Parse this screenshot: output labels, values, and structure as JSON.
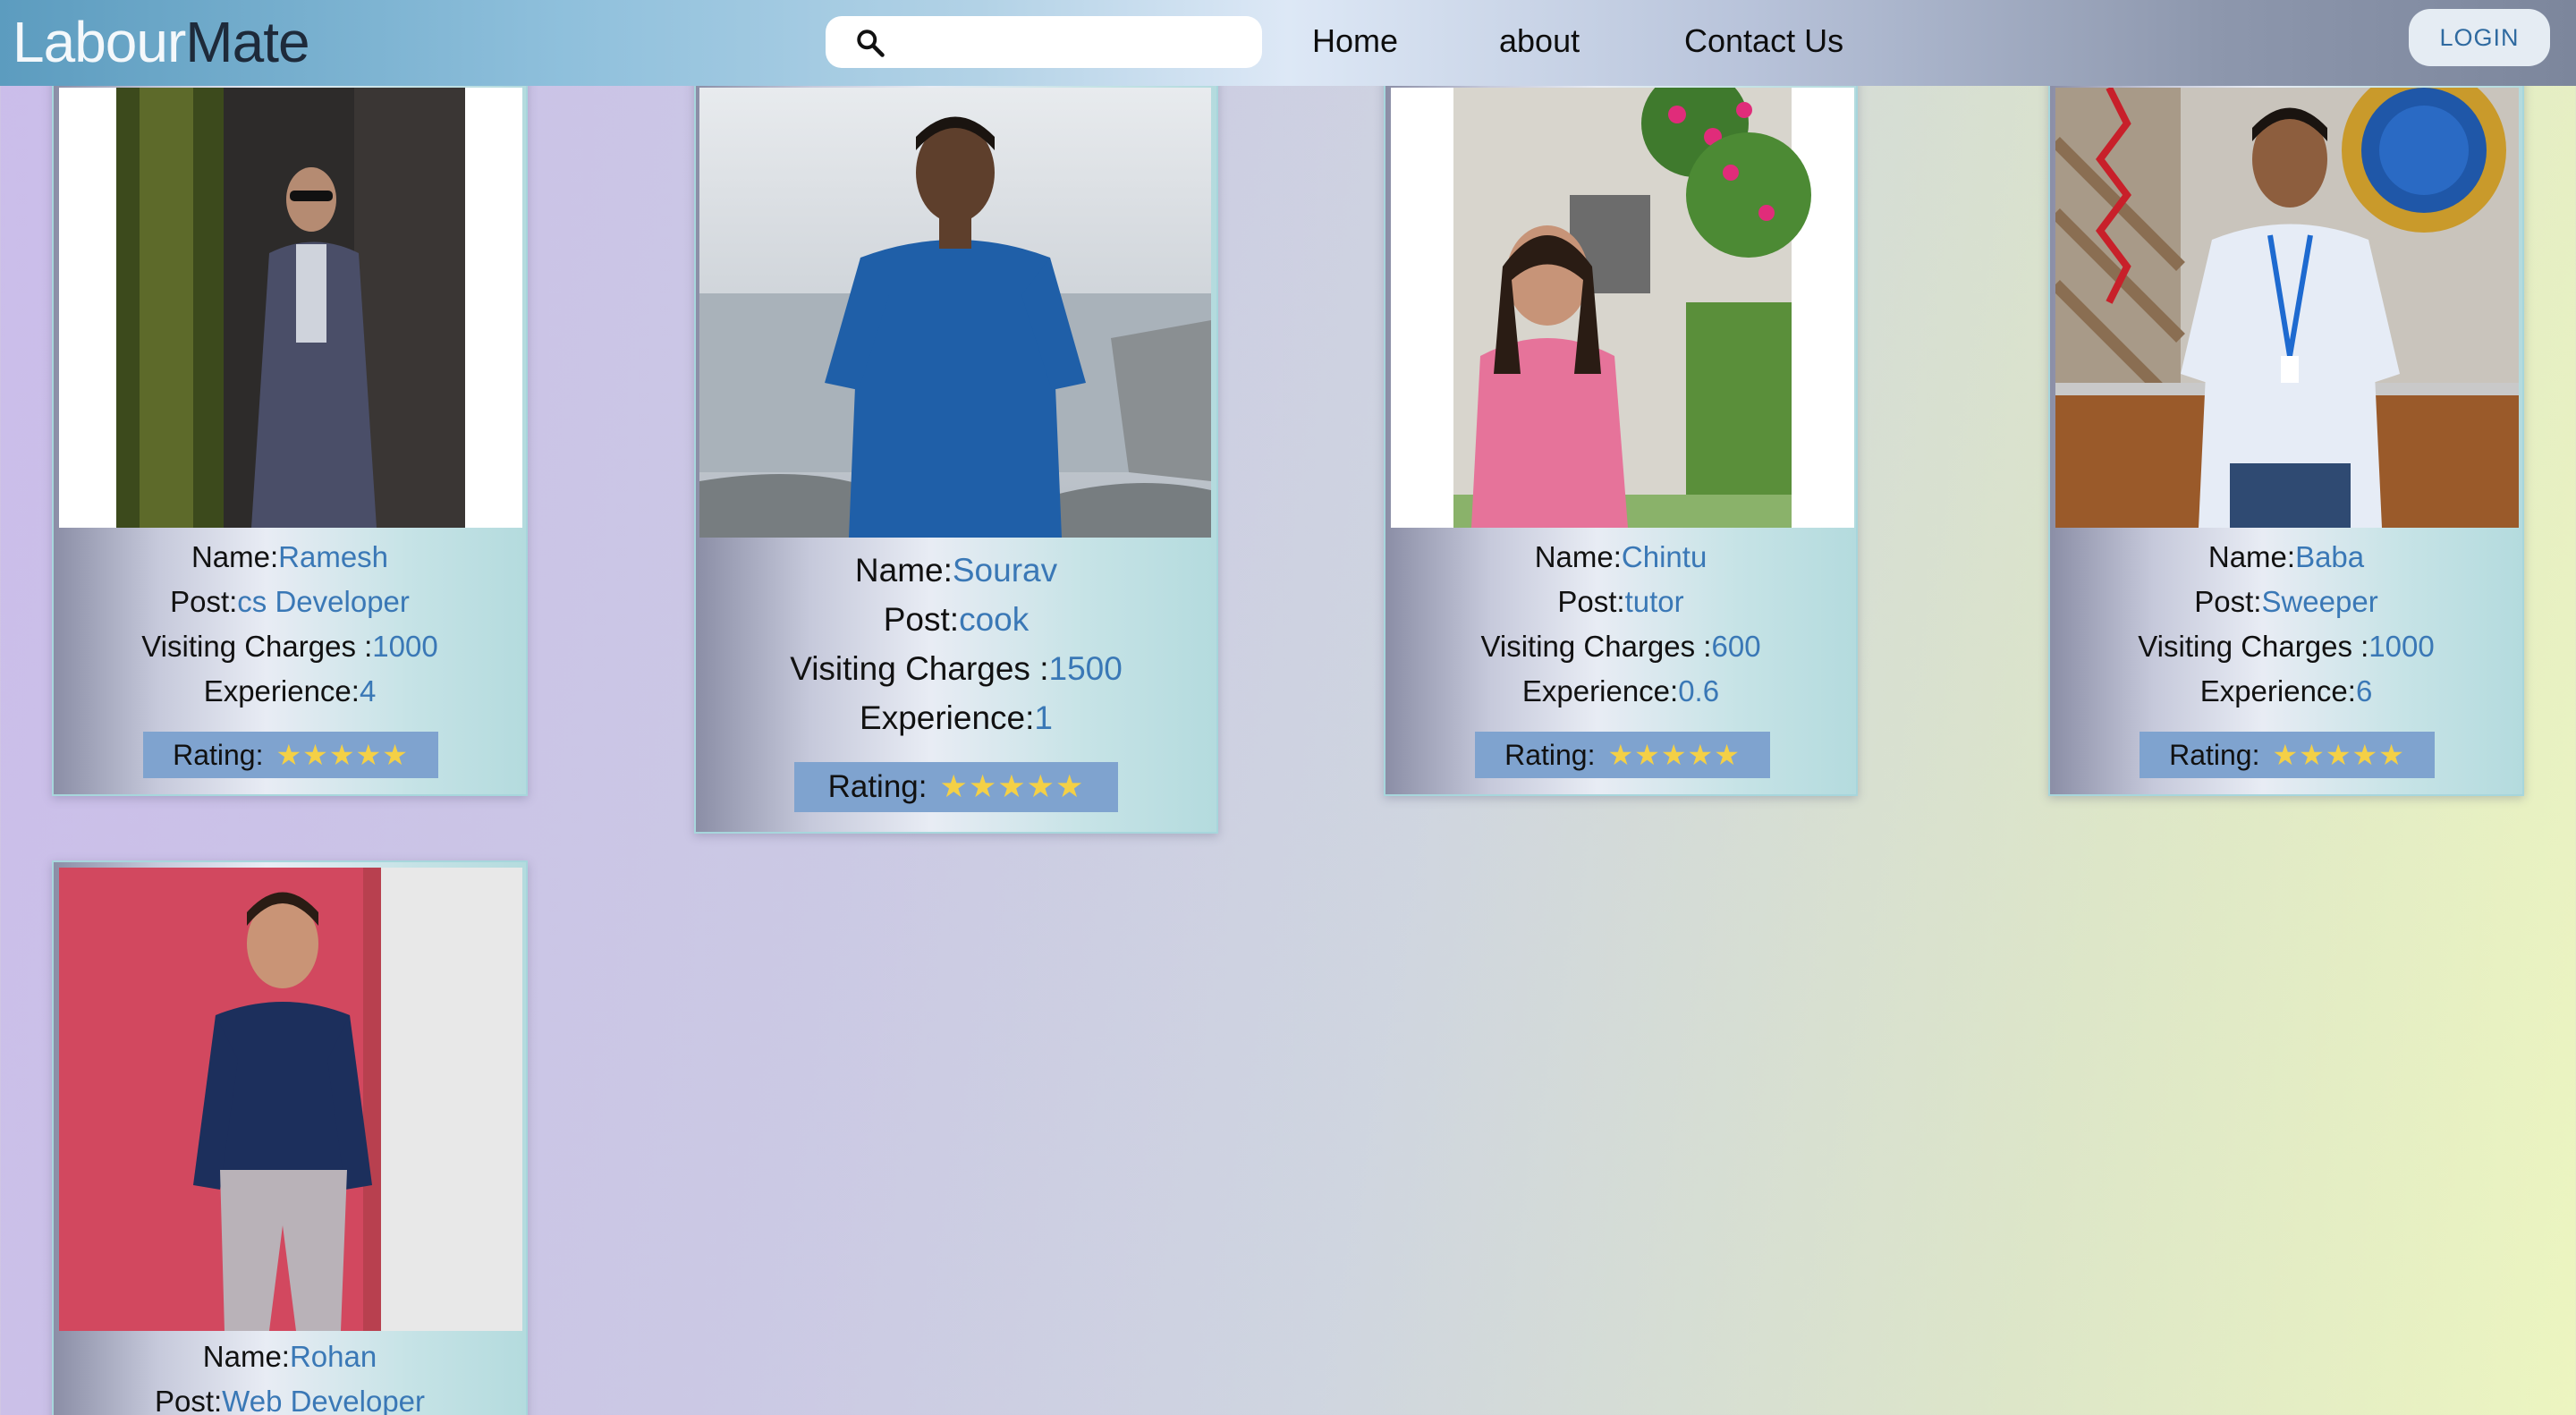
{
  "navbar": {
    "brand_part1": "Labour",
    "brand_part2": "Mate",
    "search": {
      "placeholder": "",
      "value": ""
    },
    "links": {
      "home": "Home",
      "about": "about",
      "contact": "Contact Us"
    },
    "login_label": "LOGIN"
  },
  "labels": {
    "name": "Name:",
    "post": "Post:",
    "charges": "Visiting Charges :",
    "experience": "Experience:",
    "rating": "Rating:"
  },
  "workers": [
    {
      "name": "Ramesh",
      "post": "cs Developer",
      "charges": "1000",
      "experience": "4",
      "rating_stars": "★★★★★",
      "rating_value": 5
    },
    {
      "name": "Sourav",
      "post": "cook",
      "charges": "1500",
      "experience": "1",
      "rating_stars": "★★★★★",
      "rating_value": 5
    },
    {
      "name": "Chintu",
      "post": "tutor",
      "charges": "600",
      "experience": "0.6",
      "rating_stars": "★★★★★",
      "rating_value": 5
    },
    {
      "name": "Baba",
      "post": "Sweeper",
      "charges": "1000",
      "experience": "6",
      "rating_stars": "★★★★★",
      "rating_value": 5
    },
    {
      "name": "Rohan",
      "post": "Web Developer"
    }
  ],
  "colors": {
    "value_text": "#3a78b6",
    "rating_bg": "#7fa3cf",
    "star": "#f4d046"
  }
}
